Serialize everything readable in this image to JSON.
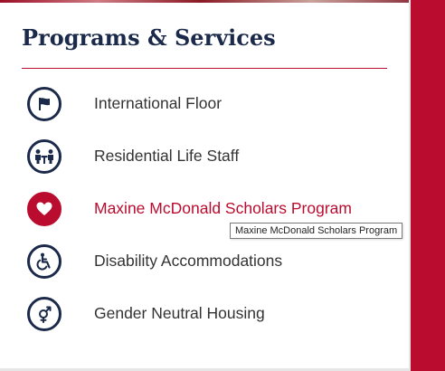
{
  "section": {
    "title": "Programs & Services"
  },
  "items": [
    {
      "label": "International Floor",
      "icon": "flag-icon",
      "active": false
    },
    {
      "label": "Residential Life Staff",
      "icon": "people-table-icon",
      "active": false
    },
    {
      "label": "Maxine McDonald Scholars Program",
      "icon": "heart-icon",
      "active": true
    },
    {
      "label": "Disability Accommodations",
      "icon": "wheelchair-icon",
      "active": false
    },
    {
      "label": "Gender Neutral Housing",
      "icon": "gender-neutral-icon",
      "active": false
    }
  ],
  "tooltip": {
    "text": "Maxine McDonald Scholars Program"
  },
  "colors": {
    "accent": "#ba0c2f",
    "navy": "#1b2a4a",
    "text": "#333333"
  }
}
